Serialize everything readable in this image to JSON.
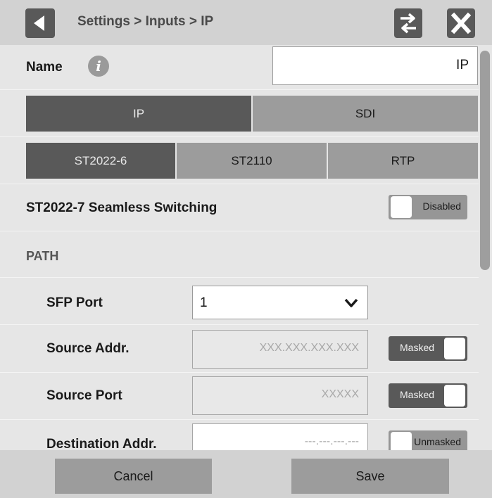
{
  "header": {
    "breadcrumb": "Settings > Inputs > IP",
    "back_icon": "triangle-left-icon",
    "swap_icon": "swap-arrows-icon",
    "close_icon": "close-x-icon"
  },
  "name_row": {
    "label": "Name",
    "info_icon": "i",
    "value": "IP"
  },
  "input_type_tabs": [
    {
      "label": "IP",
      "selected": true
    },
    {
      "label": "SDI",
      "selected": false
    }
  ],
  "protocol_tabs": [
    {
      "label": "ST2022-6",
      "selected": true
    },
    {
      "label": "ST2110",
      "selected": false
    },
    {
      "label": "RTP",
      "selected": false
    }
  ],
  "seamless": {
    "label": "ST2022-7 Seamless Switching",
    "toggle_label": "Disabled",
    "enabled": false
  },
  "path_section": {
    "title": "PATH"
  },
  "sfp_port": {
    "label": "SFP Port",
    "value": "1"
  },
  "source_addr": {
    "label": "Source Addr.",
    "placeholder": "XXX.XXX.XXX.XXX",
    "toggle_label": "Masked",
    "masked": true
  },
  "source_port": {
    "label": "Source Port",
    "placeholder": "XXXXX",
    "toggle_label": "Masked",
    "masked": true
  },
  "destination_addr": {
    "label": "Destination Addr.",
    "placeholder": "---.---.---.---",
    "toggle_label": "Unmasked",
    "masked": false
  },
  "footer": {
    "cancel_label": "Cancel",
    "save_label": "Save"
  },
  "colors": {
    "selected": "#595959",
    "unselected": "#9c9c9c",
    "background": "#e6e6e6"
  }
}
